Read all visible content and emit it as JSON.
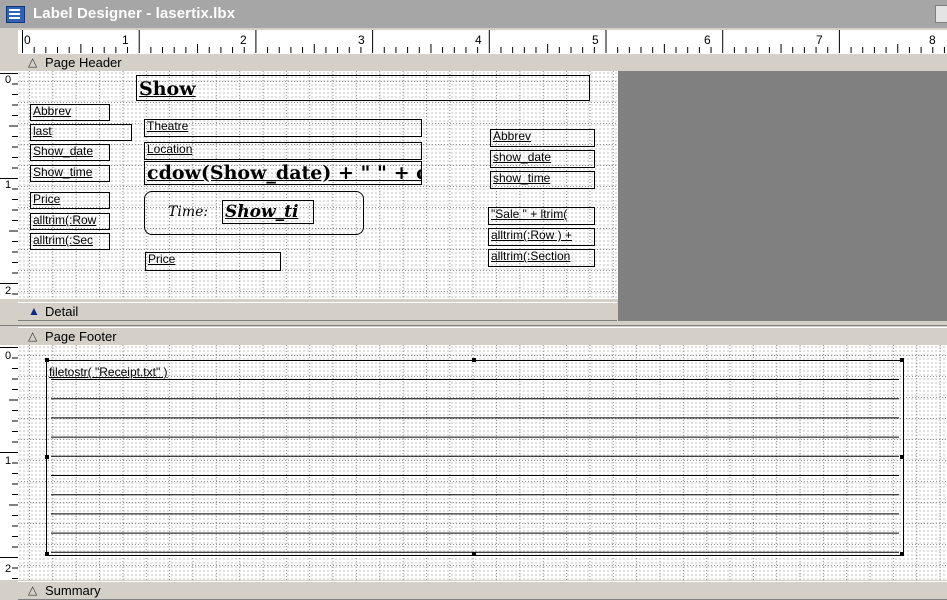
{
  "window": {
    "title": "Label Designer - lasertix.lbx"
  },
  "ruler": {
    "labels": [
      "0",
      "1",
      "2",
      "3",
      "4",
      "5",
      "6",
      "7",
      "8"
    ]
  },
  "bands": {
    "page_header": "Page Header",
    "detail": "Detail",
    "page_footer": "Page Footer",
    "summary": "Summary"
  },
  "vertical_ruler": {
    "header_labels": [
      "0",
      "1",
      "2"
    ],
    "footer_labels": [
      "0",
      "1",
      "2"
    ]
  },
  "header_fields": {
    "show": "Show",
    "abbrev_left": "Abbrev",
    "last": "last",
    "show_date_left": "Show_date",
    "show_time_left": "Show_time",
    "price_left": "Price",
    "alltrim_row_left": "alltrim(:Row",
    "alltrim_sec_left": "alltrim(:Sec",
    "theatre": "Theatre",
    "location": "Location",
    "cdow_expr": "cdow(Show_date) + \" \" + cm",
    "time_label": "Time:",
    "time_field": "Show_ti",
    "price_mid": "Price",
    "abbrev_right": "Abbrev",
    "show_date_right": "show_date",
    "show_time_right": "show_time",
    "sale_expr": "\"Sale \" + ltrim(",
    "alltrim_row_right": "alltrim(:Row ) +",
    "alltrim_section_right": "alltrim(:Section"
  },
  "footer_fields": {
    "filetostr": "filetostr( \"Receipt.txt\" )"
  }
}
